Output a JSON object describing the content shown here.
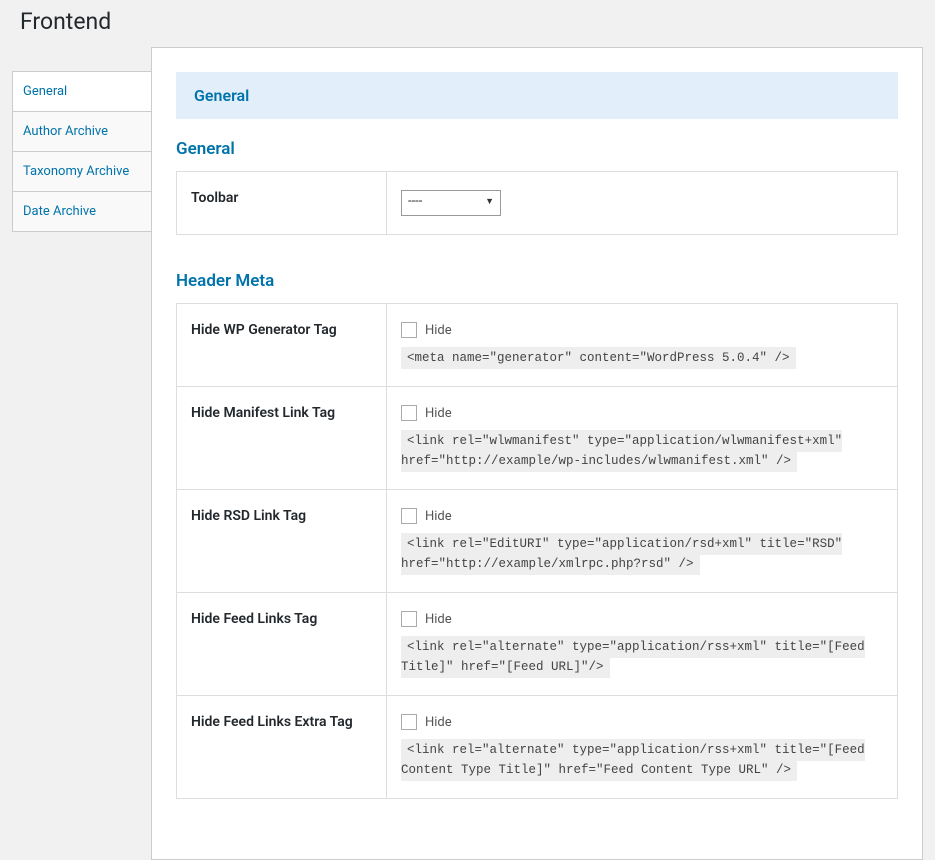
{
  "page": {
    "title": "Frontend",
    "header_bar": "General"
  },
  "sidebar": {
    "items": [
      {
        "label": "General",
        "active": true
      },
      {
        "label": "Author Archive",
        "active": false
      },
      {
        "label": "Taxonomy Archive",
        "active": false
      },
      {
        "label": "Date Archive",
        "active": false
      }
    ]
  },
  "sections": {
    "general": {
      "title": "General",
      "rows": {
        "toolbar": {
          "label": "Toolbar",
          "select_value": "----"
        }
      }
    },
    "header_meta": {
      "title": "Header Meta",
      "rows": [
        {
          "label": "Hide WP Generator Tag",
          "checkbox_label": "Hide",
          "code": "<meta name=\"generator\" content=\"WordPress 5.0.4\" />"
        },
        {
          "label": "Hide Manifest Link Tag",
          "checkbox_label": "Hide",
          "code": "<link rel=\"wlwmanifest\" type=\"application/wlwmanifest+xml\" href=\"http://example/wp-includes/wlwmanifest.xml\" />"
        },
        {
          "label": "Hide RSD Link Tag",
          "checkbox_label": "Hide",
          "code": "<link rel=\"EditURI\" type=\"application/rsd+xml\" title=\"RSD\" href=\"http://example/xmlrpc.php?rsd\" />"
        },
        {
          "label": "Hide Feed Links Tag",
          "checkbox_label": "Hide",
          "code": "<link rel=\"alternate\" type=\"application/rss+xml\" title=\"[Feed Title]\" href=\"[Feed URL]\"/>"
        },
        {
          "label": "Hide Feed Links Extra Tag",
          "checkbox_label": "Hide",
          "code": "<link rel=\"alternate\" type=\"application/rss+xml\" title=\"[Feed Content Type Title]\" href=\"Feed Content Type URL\" />"
        }
      ]
    }
  }
}
